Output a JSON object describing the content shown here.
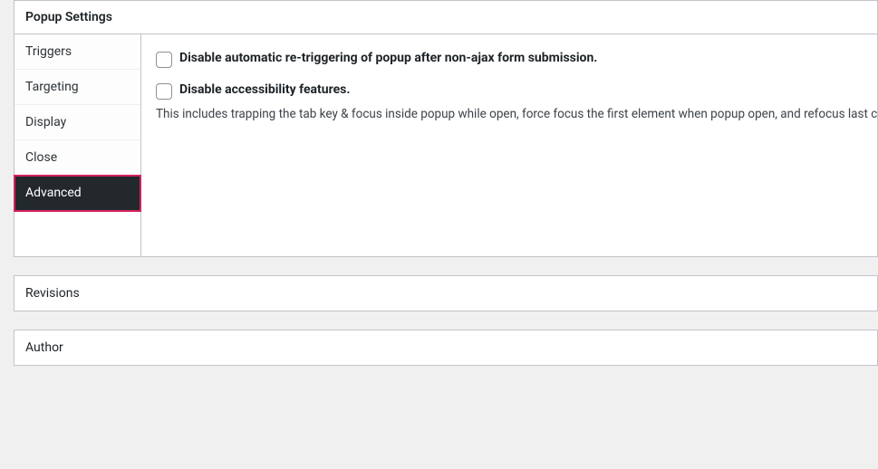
{
  "popupSettings": {
    "title": "Popup Settings",
    "tabs": [
      {
        "label": "Triggers",
        "active": false
      },
      {
        "label": "Targeting",
        "active": false
      },
      {
        "label": "Display",
        "active": false
      },
      {
        "label": "Close",
        "active": false
      },
      {
        "label": "Advanced",
        "active": true
      }
    ],
    "advanced": {
      "disableRetrigger": {
        "label": "Disable automatic re-triggering of popup after non-ajax form submission.",
        "checked": false
      },
      "disableAccessibility": {
        "label": "Disable accessibility features.",
        "description": "This includes trapping the tab key & focus inside popup while open, force focus the first element when popup open, and refocus last click trigger when closed.",
        "checked": false
      }
    }
  },
  "revisions": {
    "title": "Revisions"
  },
  "author": {
    "title": "Author"
  }
}
